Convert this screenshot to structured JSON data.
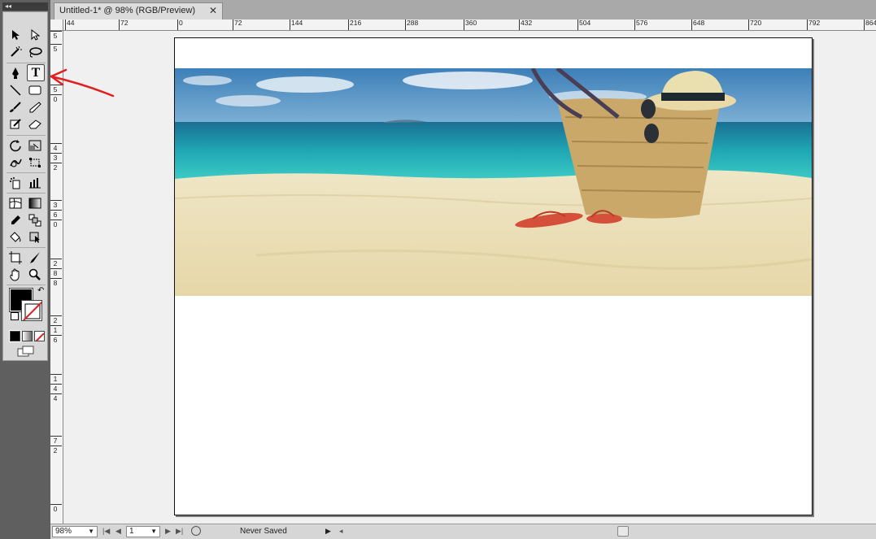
{
  "window": {
    "toolbox_collapse": "◂◂"
  },
  "document_tab": {
    "title": "Untitled-1* @ 98% (RGB/Preview)",
    "close": "✕"
  },
  "ruler": {
    "horizontal": [
      "44",
      "72",
      "0",
      "72",
      "144",
      "216",
      "288",
      "360",
      "432",
      "504",
      "576",
      "648",
      "720",
      "792",
      "864"
    ],
    "vertical": [
      "5",
      "5",
      "5",
      "0",
      "4",
      "3",
      "2",
      "3",
      "6",
      "0",
      "2",
      "8",
      "8",
      "2",
      "1",
      "6",
      "1",
      "4",
      "4",
      "7",
      "2",
      "0"
    ]
  },
  "tools": [
    {
      "name": "selection-tool"
    },
    {
      "name": "direct-selection-tool"
    },
    {
      "name": "magic-wand-tool"
    },
    {
      "name": "lasso-tool"
    },
    {
      "name": "pen-tool"
    },
    {
      "name": "type-tool",
      "label": "T",
      "selected": true
    },
    {
      "name": "line-segment-tool"
    },
    {
      "name": "rectangle-tool"
    },
    {
      "name": "paintbrush-tool"
    },
    {
      "name": "pencil-tool"
    },
    {
      "name": "blob-brush-tool"
    },
    {
      "name": "eraser-tool"
    },
    {
      "name": "rotate-tool"
    },
    {
      "name": "scale-tool"
    },
    {
      "name": "warp-tool"
    },
    {
      "name": "free-transform-tool"
    },
    {
      "name": "symbol-sprayer-tool"
    },
    {
      "name": "column-graph-tool"
    },
    {
      "name": "mesh-tool"
    },
    {
      "name": "gradient-tool"
    },
    {
      "name": "eyedropper-tool"
    },
    {
      "name": "blend-tool"
    },
    {
      "name": "live-paint-bucket-tool"
    },
    {
      "name": "live-paint-selection-tool"
    },
    {
      "name": "artboard-tool"
    },
    {
      "name": "slice-tool"
    },
    {
      "name": "hand-tool"
    },
    {
      "name": "zoom-tool"
    }
  ],
  "colors": {
    "fill": "#000000",
    "stroke": "none",
    "annotation": "#e02020"
  },
  "status": {
    "zoom": "98%",
    "artboard_number": "1",
    "save_state": "Never Saved"
  }
}
